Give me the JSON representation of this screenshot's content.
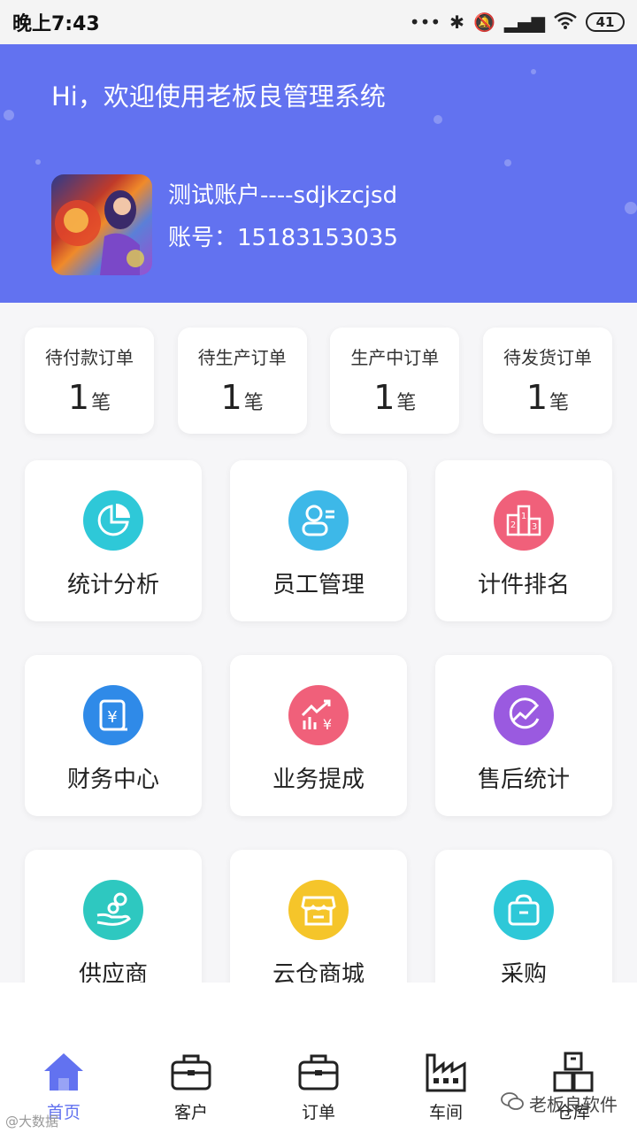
{
  "status": {
    "time": "晚上7:43",
    "icons": [
      "signal-dots",
      "bluetooth",
      "mute-bell",
      "hd-signal",
      "wifi"
    ],
    "battery": "41"
  },
  "header": {
    "welcome": "Hi，欢迎使用老板良管理系统",
    "user_name": "测试账户----sdjkzcjsd",
    "account": "账号：15183153035",
    "bg_color": "#6272f0"
  },
  "orders": [
    {
      "label": "待付款订单",
      "count": "1",
      "unit": "笔"
    },
    {
      "label": "待生产订单",
      "count": "1",
      "unit": "笔"
    },
    {
      "label": "生产中订单",
      "count": "1",
      "unit": "笔"
    },
    {
      "label": "待发货订单",
      "count": "1",
      "unit": "笔"
    }
  ],
  "modules": [
    {
      "label": "统计分析",
      "icon": "pie-chart-icon",
      "color": "#2ec8d8"
    },
    {
      "label": "员工管理",
      "icon": "employee-icon",
      "color": "#3db8e8"
    },
    {
      "label": "计件排名",
      "icon": "podium-icon",
      "color": "#f0607a"
    },
    {
      "label": "财务中心",
      "icon": "finance-icon",
      "color": "#2f8ae8"
    },
    {
      "label": "业务提成",
      "icon": "commission-icon",
      "color": "#f0607a"
    },
    {
      "label": "售后统计",
      "icon": "trend-icon",
      "color": "#9a5ae0"
    },
    {
      "label": "供应商",
      "icon": "supplier-icon",
      "color": "#2ec8c0"
    },
    {
      "label": "云仓商城",
      "icon": "store-icon",
      "color": "#f5c52a"
    },
    {
      "label": "采购",
      "icon": "basket-icon",
      "color": "#2ec8d8"
    }
  ],
  "tabs": [
    {
      "label": "首页",
      "icon": "home-icon",
      "active": true
    },
    {
      "label": "客户",
      "icon": "briefcase-icon"
    },
    {
      "label": "订单",
      "icon": "briefcase-icon"
    },
    {
      "label": "车间",
      "icon": "factory-icon"
    },
    {
      "label": "仓库",
      "icon": "boxes-icon"
    }
  ],
  "watermark": {
    "text": "老板良软件",
    "corner_text": "@大数据"
  }
}
